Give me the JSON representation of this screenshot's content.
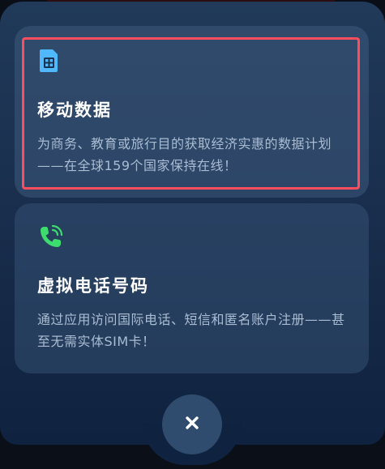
{
  "sheet": {
    "cards": [
      {
        "icon": "sim-card-icon",
        "title": "移动数据",
        "description": "为商务、教育或旅行目的获取经济实惠的数据计划——在全球159个国家保持在线！",
        "highlighted": true
      },
      {
        "icon": "phone-ringing-icon",
        "title": "虚拟电话号码",
        "description": "通过应用访问国际电话、短信和匿名账户注册——甚至无需实体SIM卡！",
        "highlighted": false
      }
    ],
    "close_icon": "close-icon"
  },
  "colors": {
    "highlight": "#ff4d5e",
    "sim_icon": "#4fb8ff",
    "phone_icon": "#3ddc6f",
    "title": "#ffffff",
    "description": "#a9bcd2"
  }
}
